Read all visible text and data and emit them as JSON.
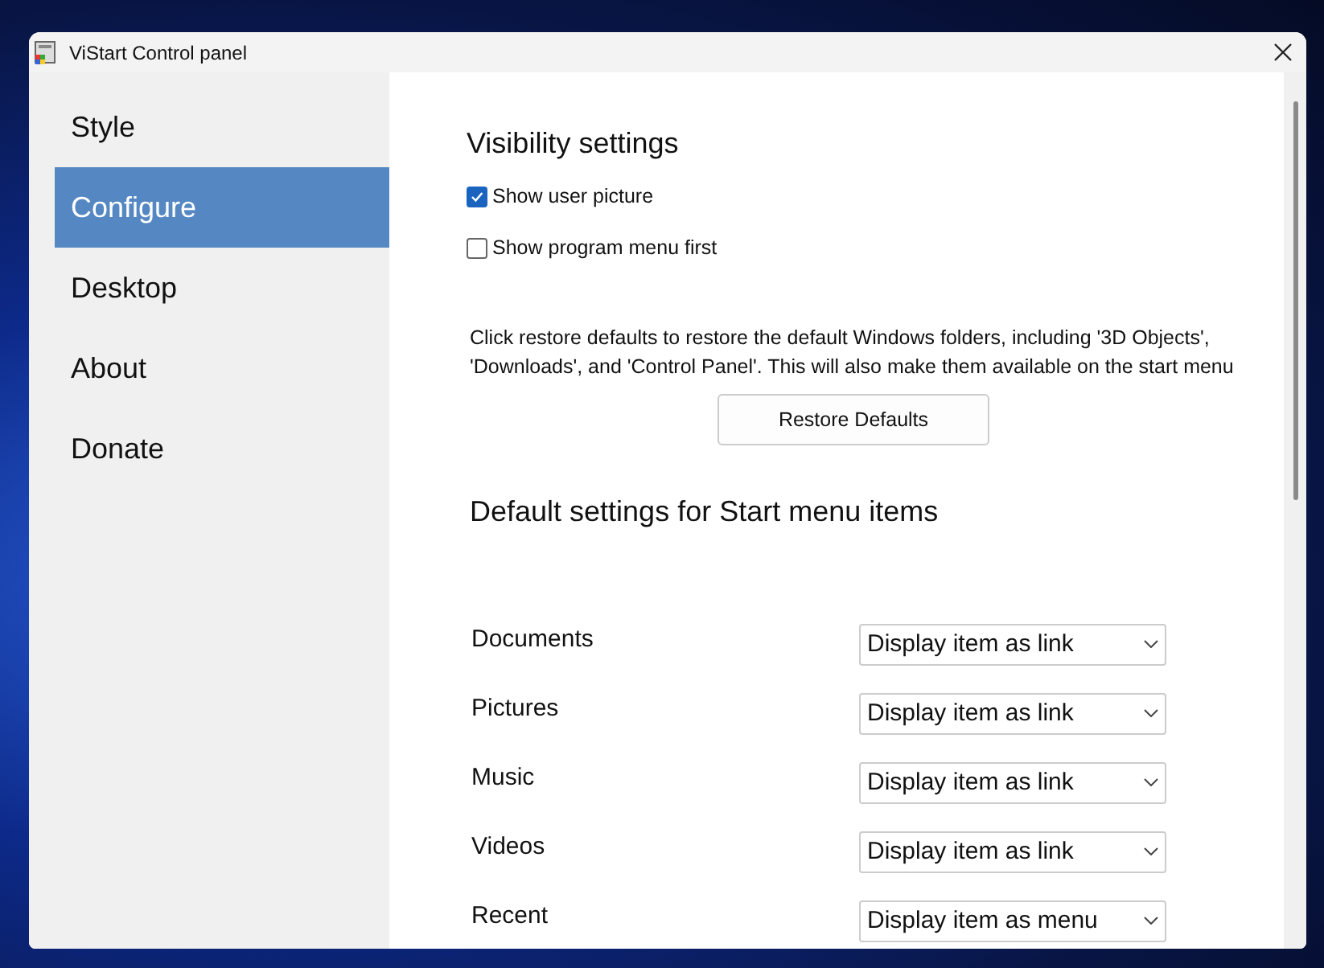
{
  "window": {
    "title": "ViStart Control panel"
  },
  "sidebar": {
    "items": [
      {
        "label": "Style",
        "selected": false
      },
      {
        "label": "Configure",
        "selected": true
      },
      {
        "label": "Desktop",
        "selected": false
      },
      {
        "label": "About",
        "selected": false
      },
      {
        "label": "Donate",
        "selected": false
      }
    ]
  },
  "visibility": {
    "heading": "Visibility settings",
    "options": [
      {
        "label": "Show user picture",
        "checked": true
      },
      {
        "label": "Show program menu first",
        "checked": false
      }
    ]
  },
  "restore": {
    "description": "Click restore defaults to restore the default Windows folders, including '3D Objects', 'Downloads', and 'Control Panel'. This will also make them available on the start menu",
    "button": "Restore Defaults"
  },
  "defaults": {
    "heading": "Default settings for Start menu items",
    "rows": [
      {
        "label": "Documents",
        "value": "Display item as link"
      },
      {
        "label": "Pictures",
        "value": "Display item as link"
      },
      {
        "label": "Music",
        "value": "Display item as link"
      },
      {
        "label": "Videos",
        "value": "Display item as link"
      },
      {
        "label": "Recent",
        "value": "Display item as menu"
      }
    ]
  }
}
